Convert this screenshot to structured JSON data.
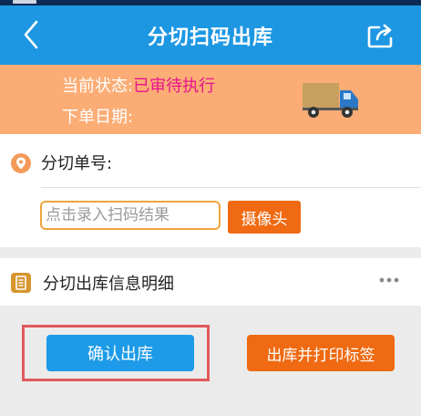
{
  "header": {
    "title": "分切扫码出库",
    "back_icon": "chevron-left-icon",
    "share_icon": "share-icon"
  },
  "status_panel": {
    "status_label": "当前状态:",
    "status_value": "已审待执行",
    "date_label": "下单日期:",
    "date_value": "",
    "truck_icon": "delivery-truck-icon",
    "colors": {
      "panel_bg": "#fbad75",
      "status_value": "#e8138d"
    }
  },
  "scan_section": {
    "pin_icon": "location-pin-icon",
    "order_label": "分切单号:",
    "order_value": "",
    "input_value": "",
    "input_placeholder": "点击录入扫码结果",
    "camera_button": "摄像头"
  },
  "detail_section": {
    "doc_icon": "document-icon",
    "title": "分切出库信息明细",
    "more_icon": "more-horizontal-icon"
  },
  "actions": {
    "confirm_label": "确认出库",
    "print_label": "出库并打印标签",
    "colors": {
      "confirm": "#1e9be8",
      "print": "#ef6a12",
      "highlight": "#e25a5a"
    }
  },
  "theme": {
    "header_bg": "#1e97e3",
    "page_bg": "#ebebeb"
  }
}
